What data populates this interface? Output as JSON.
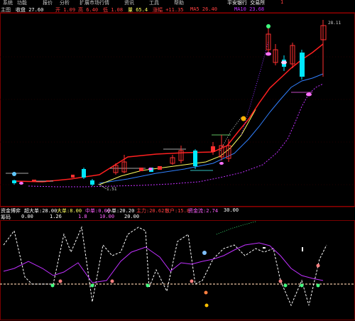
{
  "menu": {
    "items": [
      "系统",
      "功能",
      "报价",
      "分析",
      "扩展市场行情",
      "资讯",
      "工具",
      "帮助"
    ],
    "right_text": "平安银行 交易所",
    "right_badge": "1"
  },
  "main_panel": {
    "indicator_label": "主图",
    "labels": [
      "收盘 27.60",
      "开 1.09",
      "高 6.40",
      "低 1.08",
      "量 65.4",
      "涨幅 +11.35",
      "MA5 26.40",
      "MA10 23.68"
    ],
    "high_mark": "28.11",
    "low_mark": "1.51"
  },
  "sub_panel": {
    "indicator_label": "资金博弈",
    "row1": [
      "超大单:28.00",
      "大单:8.00",
      "中单:0.00",
      "小单:20.20",
      "主力:20.62",
      "散户:15.8",
      "资金流:2.74",
      "30.00"
    ],
    "row2_label": "筹码",
    "row2": [
      "0.00",
      "1.26",
      "1.8",
      "10.00",
      "20.00"
    ]
  },
  "colors": {
    "up": "#ff3030",
    "down": "#00e8ff",
    "ma_red": "#ff2020",
    "ma_yellow": "#ffff60",
    "ma_blue": "#3080ff",
    "ma_purple": "#c030ff",
    "white_line": "#ffffff",
    "grid": "#3a0000",
    "ref_line": "#e8c0a0"
  },
  "icons": {
    "top_signal": "green-dot-icon",
    "buy_signals": "buy-arrow-icon",
    "sell_signals": "sell-arrow-icon"
  }
}
